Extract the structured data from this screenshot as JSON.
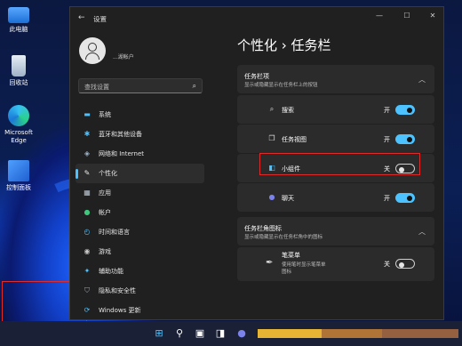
{
  "desktop": {
    "icons": [
      {
        "label": "此电脑",
        "icon": "pc-icon"
      },
      {
        "label": "回收站",
        "icon": "recycle-bin-icon"
      },
      {
        "label": "Microsoft Edge",
        "icon": "edge-icon"
      },
      {
        "label": "控制面板",
        "icon": "control-panel-icon"
      }
    ]
  },
  "window": {
    "title": "设置",
    "account_name": "...湖帐户",
    "search_placeholder": "查找设置",
    "nav": [
      {
        "label": "系统",
        "icon": "monitor-icon",
        "active": false
      },
      {
        "label": "蓝牙和其他设备",
        "icon": "bluetooth-icon",
        "active": false
      },
      {
        "label": "网络和 Internet",
        "icon": "wifi-icon",
        "active": false
      },
      {
        "label": "个性化",
        "icon": "brush-icon",
        "active": true
      },
      {
        "label": "应用",
        "icon": "apps-icon",
        "active": false
      },
      {
        "label": "帐户",
        "icon": "person-icon",
        "active": false
      },
      {
        "label": "时间和语言",
        "icon": "globe-clock-icon",
        "active": false
      },
      {
        "label": "游戏",
        "icon": "gamepad-icon",
        "active": false
      },
      {
        "label": "辅助功能",
        "icon": "accessibility-icon",
        "active": false
      },
      {
        "label": "隐私和安全性",
        "icon": "shield-icon",
        "active": false
      },
      {
        "label": "Windows 更新",
        "icon": "update-icon",
        "active": false
      }
    ],
    "breadcrumb": "个性化  ›  任务栏",
    "section1": {
      "title": "任务栏项",
      "subtitle": "显示或隐藏显示在任务栏上的按钮",
      "items": [
        {
          "label": "搜索",
          "state": "开",
          "on": true,
          "icon": "search-icon"
        },
        {
          "label": "任务视图",
          "state": "开",
          "on": true,
          "icon": "task-view-icon"
        },
        {
          "label": "小组件",
          "state": "关",
          "on": false,
          "icon": "widgets-icon"
        },
        {
          "label": "聊天",
          "state": "开",
          "on": true,
          "icon": "chat-icon"
        }
      ]
    },
    "section2": {
      "title": "任务栏角图标",
      "subtitle": "显示或隐藏显示在任务栏角中的图标",
      "items": [
        {
          "label": "笔菜单",
          "sub1": "使用笔时显示笔菜单",
          "sub2": "图标",
          "state": "关",
          "on": false,
          "icon": "pen-icon"
        }
      ]
    }
  },
  "colors": {
    "accent": "#4cc2ff",
    "highlight_border": "#e12b2b",
    "window_bg": "#202020",
    "card_bg": "#2b2b2b"
  }
}
